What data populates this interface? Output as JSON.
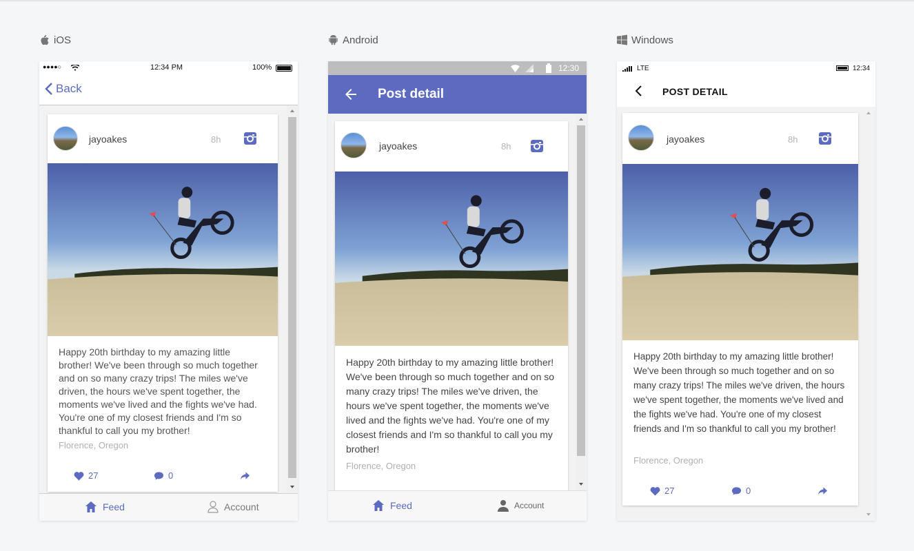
{
  "platforms": {
    "ios": "iOS",
    "android": "Android",
    "windows": "Windows"
  },
  "post": {
    "username": "jayoakes",
    "time": "8h",
    "text": "Happy 20th birthday to my amazing little brother! We've been through so much together and on so many crazy trips! The miles we've driven, the hours we've spent together, the moments we've lived and the fights we've had. You're one of my closest friends and I'm so thankful to call you my brother!",
    "location": "Florence, Oregon",
    "likes": "27",
    "comments": "0"
  },
  "ios": {
    "carrier_dots": "●●●●○",
    "time": "12:34 PM",
    "battery": "100%",
    "back_label": "Back",
    "tab_feed": "Feed",
    "tab_account": "Account"
  },
  "android": {
    "time": "12:30",
    "title": "Post detail",
    "tab_feed": "Feed",
    "tab_account": "Account"
  },
  "windows": {
    "network": "LTE",
    "time": "12:34",
    "title": "POST DETAIL"
  },
  "colors": {
    "accent": "#5c6bc0",
    "status_gray": "#bdbdbd"
  }
}
